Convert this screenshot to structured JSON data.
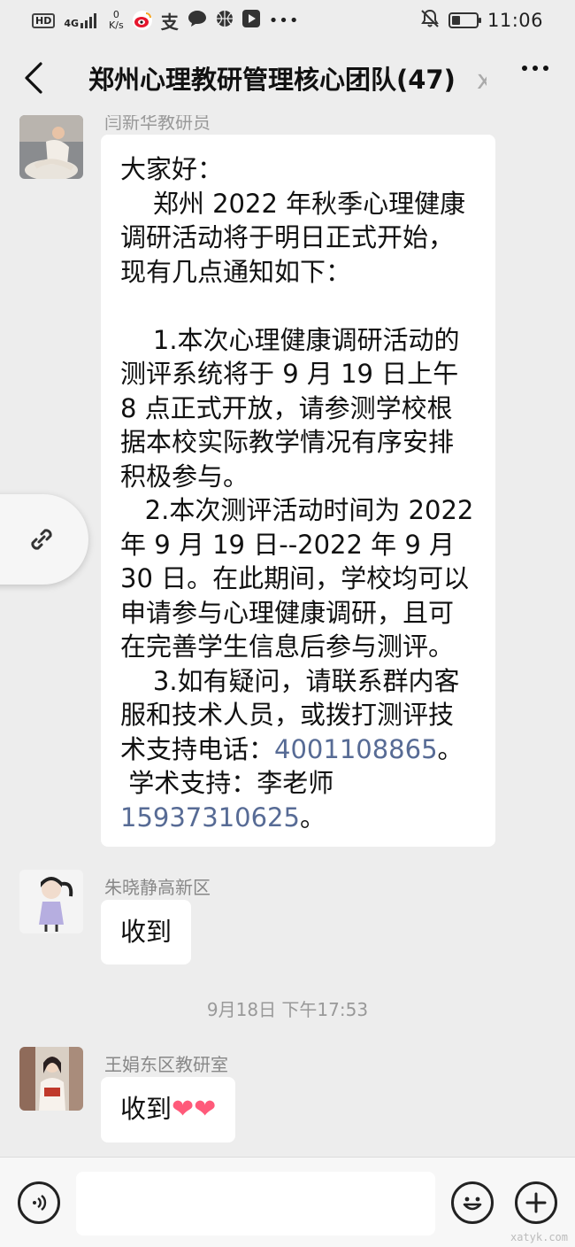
{
  "status_bar": {
    "hd": "HD",
    "network": "4G",
    "speed_value": "0",
    "speed_unit": "K/s",
    "alipay_glyph": "支",
    "time": "11:06",
    "battery_level": 0.35,
    "icons": [
      "hd-icon",
      "signal-icon",
      "weibo-icon",
      "alipay-icon",
      "chat-icon",
      "basketball-icon",
      "play-icon",
      "more-dots-icon",
      "mute-bell-icon",
      "battery-icon"
    ]
  },
  "header": {
    "title": "郑州心理教研管理核心团队(47)",
    "title_extra": "x",
    "back_icon": "chevron-left-icon",
    "more_icon": "more-icon"
  },
  "messages": [
    {
      "sender": "闫新华教研员",
      "avatar": "avatar-woman-meditating",
      "paragraphs": [
        "大家好：",
        "    郑州 2022 年秋季心理健康调研活动将于明日正式开始，现有几点通知如下：",
        "",
        "    1.本次心理健康调研活动的测评系统将于 9 月 19 日上午 8 点正式开放，请参测学校根据本校实际教学情况有序安排积极参与。",
        "   2.本次测评活动时间为 2022 年 9 月 19 日--2022 年 9 月 30 日。在此期间，学校均可以申请参与心理健康调研，且可在完善学生信息后参与测评。",
        "    3.如有疑问，请联系群内客服和技术人员，或拨打测评技术支持电话："
      ],
      "phone_tech": "4001108865",
      "period": "。",
      "academic_label": " 学术支持：李老师",
      "phone_academic": "15937310625"
    },
    {
      "sender": "朱晓静高新区",
      "avatar": "avatar-girl-cartoon",
      "text": "收到"
    },
    {
      "sender": "王娟东区教研室",
      "avatar": "avatar-woman-holding-book",
      "text": "收到",
      "emoji": "❤❤"
    }
  ],
  "time_separator": "9月18日 下午17:53",
  "floating_button_icon": "link-icon",
  "input_bar": {
    "voice_icon": "voice-icon",
    "emoji_icon": "emoji-icon",
    "add_icon": "plus-icon",
    "placeholder": ""
  },
  "watermark": "xatyk.com",
  "colors": {
    "background": "#ededed",
    "bubble": "#ffffff",
    "link": "#576b95",
    "heart": "#ff5a7a"
  }
}
